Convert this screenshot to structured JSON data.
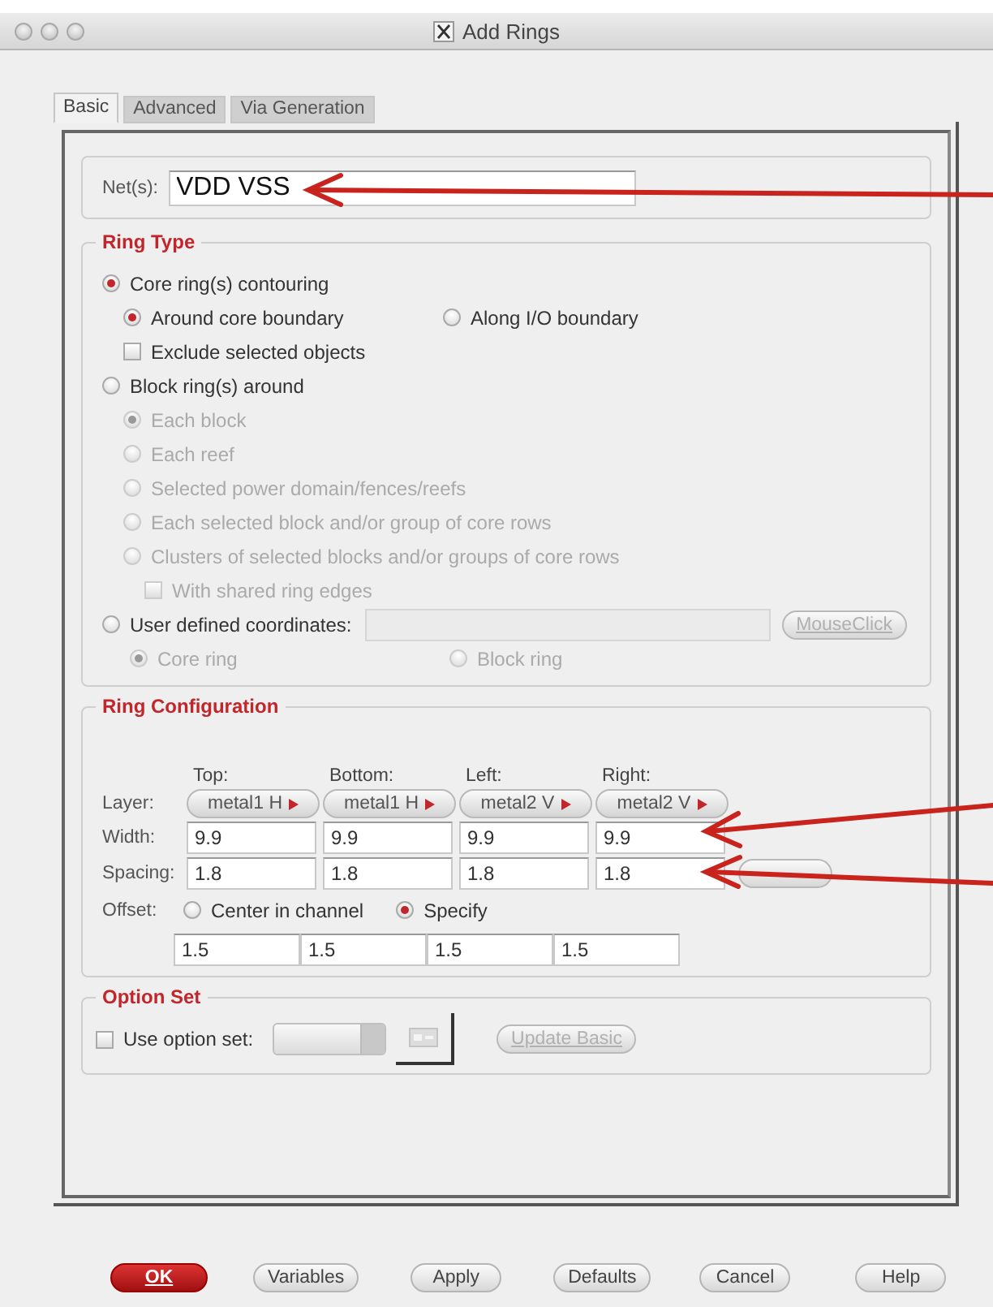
{
  "window": {
    "title": "Add Rings"
  },
  "tabs": [
    {
      "label": "Basic",
      "selected": true
    },
    {
      "label": "Advanced",
      "selected": false
    },
    {
      "label": "Via Generation",
      "selected": false
    }
  ],
  "nets": {
    "label": "Net(s):",
    "value": "VDD VSS"
  },
  "ring_type": {
    "title": "Ring Type",
    "items": [
      {
        "kind": "radio",
        "label": "Core ring(s) contouring",
        "selected": true,
        "disabled": false,
        "children": [
          {
            "kind": "radio_row",
            "disabled": false,
            "options": [
              {
                "label": "Around core boundary",
                "selected": true
              },
              {
                "label": "Along I/O boundary",
                "selected": false
              }
            ]
          },
          {
            "kind": "checkbox",
            "label": "Exclude selected objects",
            "checked": false,
            "disabled": false
          }
        ]
      },
      {
        "kind": "radio",
        "label": "Block ring(s) around",
        "selected": false,
        "disabled": false,
        "children": [
          {
            "kind": "radio",
            "label": "Each block",
            "selected": true,
            "disabled": true
          },
          {
            "kind": "radio",
            "label": "Each reef",
            "selected": false,
            "disabled": true
          },
          {
            "kind": "radio",
            "label": "Selected power domain/fences/reefs",
            "selected": false,
            "disabled": true
          },
          {
            "kind": "radio",
            "label": "Each selected block and/or group of core rows",
            "selected": false,
            "disabled": true
          },
          {
            "kind": "radio",
            "label": "Clusters of selected blocks and/or groups of core rows",
            "selected": false,
            "disabled": true,
            "children": [
              {
                "kind": "checkbox",
                "label": "With shared ring edges",
                "checked": false,
                "disabled": true
              }
            ]
          }
        ]
      },
      {
        "kind": "coords",
        "label": "User defined coordinates:",
        "selected": false,
        "disabled": false,
        "button": {
          "label": "MouseClick",
          "disabled": true
        },
        "children": [
          {
            "kind": "radio_row",
            "disabled": true,
            "options": [
              {
                "label": "Core ring",
                "selected": true
              },
              {
                "label": "Block ring",
                "selected": false
              }
            ]
          }
        ]
      }
    ]
  },
  "ring_configuration": {
    "title": "Ring Configuration",
    "columns": [
      "Top:",
      "Bottom:",
      "Left:",
      "Right:"
    ],
    "rows": [
      {
        "kind": "menu",
        "label": "Layer:",
        "values": [
          "metal1 H",
          "metal1 H",
          "metal2 V",
          "metal2 V"
        ]
      },
      {
        "kind": "field",
        "label": "Width:",
        "values": [
          "9.9",
          "9.9",
          "9.9",
          "9.9"
        ]
      },
      {
        "kind": "field",
        "label": "Spacing:",
        "values": [
          "1.8",
          "1.8",
          "1.8",
          "1.8"
        ]
      }
    ],
    "offset": {
      "label": "Offset:",
      "options": [
        {
          "label": "Center in channel",
          "selected": false
        },
        {
          "label": "Specify",
          "selected": true
        }
      ],
      "values": [
        "1.5",
        "1.5",
        "1.5",
        "1.5"
      ]
    }
  },
  "option_set": {
    "title": "Option Set",
    "checkbox": {
      "label": "Use option set:",
      "checked": false
    },
    "button": {
      "label": "Update Basic",
      "disabled": true
    }
  },
  "buttons": [
    {
      "label": "OK",
      "kind": "primary"
    },
    {
      "label": "Variables",
      "kind": "normal"
    },
    {
      "label": "Apply",
      "kind": "normal"
    },
    {
      "label": "Defaults",
      "kind": "normal"
    },
    {
      "label": "Cancel",
      "kind": "normal"
    },
    {
      "label": "Help",
      "kind": "normal"
    }
  ]
}
